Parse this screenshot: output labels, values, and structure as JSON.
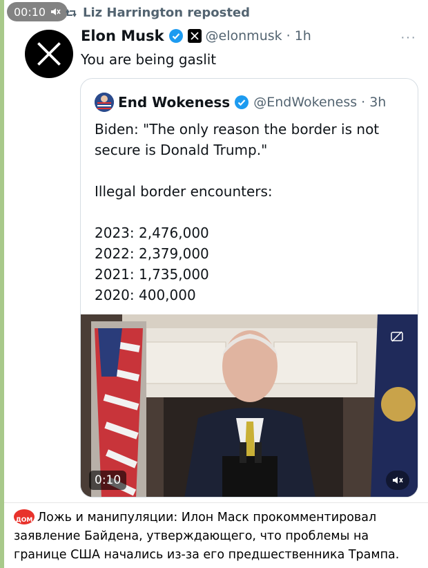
{
  "video_badge": {
    "time": "00:10",
    "icon": "muted-speaker-icon"
  },
  "repost": {
    "label": "Liz Harrington reposted",
    "icon": "repost-icon"
  },
  "tweet": {
    "author_name": "Elon Musk",
    "author_handle": "@elonmusk",
    "time": "1h",
    "text": "You are being gaslit",
    "more": "···"
  },
  "quote": {
    "author_name": "End Wokeness",
    "author_handle": "@EndWokeness",
    "time": "3h",
    "lines": [
      "Biden: \"The only reason the border is not",
      "secure is Donald Trump.\"",
      "Illegal border encounters:",
      "2023: 2,476,000",
      "2022: 2,379,000",
      "2021: 1,735,000",
      "2020: 400,000"
    ],
    "video": {
      "duration": "0:10"
    }
  },
  "caption": {
    "logo": "ДОМ",
    "text": "Ложь и манипуляции: Илон Маск прокомментировал заявление Байдена, утверждающего, что проблемы на границе США начались из-за его предшественника Трампа."
  },
  "colors": {
    "verified": "#1d9bf0",
    "handle": "#536471",
    "accent_strip": "#a8c98a",
    "caption_logo": "#e8322b"
  }
}
